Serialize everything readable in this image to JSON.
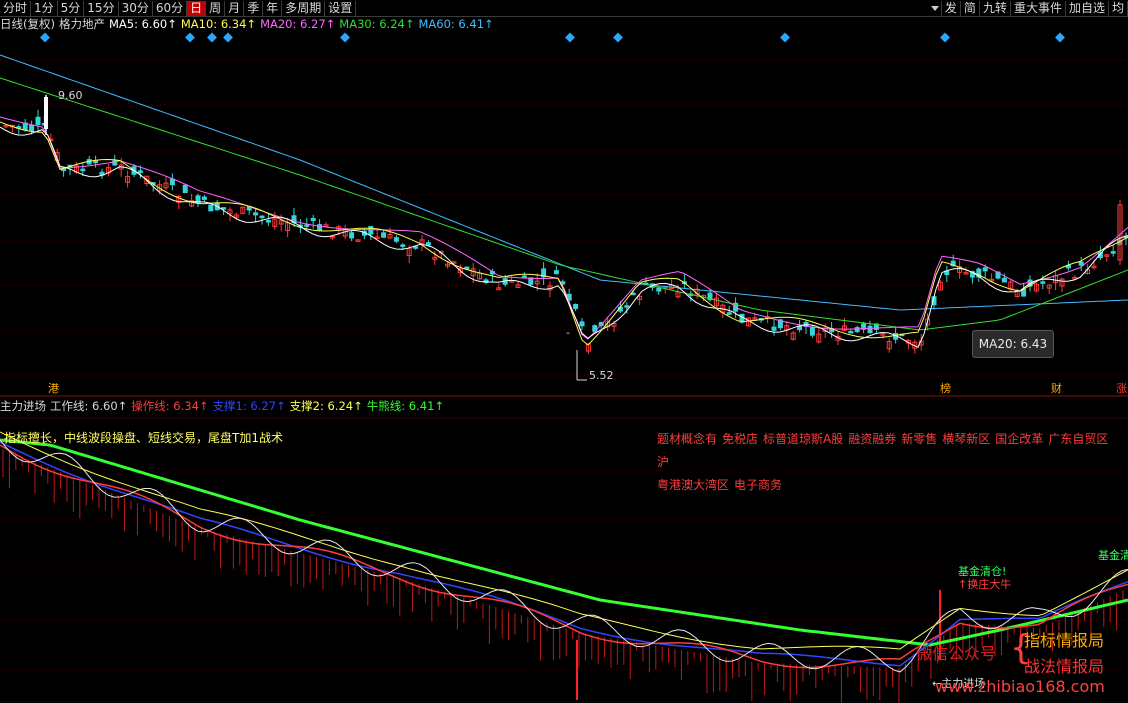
{
  "toolbar": {
    "left": [
      {
        "label": "分时",
        "active": false
      },
      {
        "label": "1分",
        "active": false
      },
      {
        "label": "5分",
        "active": false
      },
      {
        "label": "15分",
        "active": false
      },
      {
        "label": "30分",
        "active": false
      },
      {
        "label": "60分",
        "active": false
      },
      {
        "label": "日",
        "active": true
      },
      {
        "label": "周",
        "active": false
      },
      {
        "label": "月",
        "active": false
      },
      {
        "label": "季",
        "active": false
      },
      {
        "label": "年",
        "active": false
      },
      {
        "label": "多周期",
        "active": false
      },
      {
        "label": "设置",
        "active": false
      }
    ],
    "right": [
      "发",
      "简",
      "九转",
      "重大事件",
      "加自选",
      "均"
    ]
  },
  "upper_legend": [
    {
      "text": "日线(复权)",
      "color": "#d8d8d8"
    },
    {
      "text": "格力地产",
      "color": "#d8d8d8"
    },
    {
      "text": "MA5: 6.60↑",
      "color": "#ffffff"
    },
    {
      "text": "MA10: 6.34↑",
      "color": "#ffff55"
    },
    {
      "text": "MA20: 6.27↑",
      "color": "#ff66ff"
    },
    {
      "text": "MA30: 6.24↑",
      "color": "#33dd33"
    },
    {
      "text": "MA60: 6.41↑",
      "color": "#44bbff"
    }
  ],
  "lower_legend": [
    {
      "text": "主力进场",
      "color": "#d8d8d8"
    },
    {
      "text": "工作线: 6.60↑",
      "color": "#d8d8d8"
    },
    {
      "text": "操作线: 6.34↑",
      "color": "#ff3b3b"
    },
    {
      "text": "支撑1: 6.27↑",
      "color": "#3344ff"
    },
    {
      "text": "支撑2: 6.24↑",
      "color": "#ffff55"
    },
    {
      "text": "牛熊线: 6.41↑",
      "color": "#33ff33"
    }
  ],
  "price_labels": {
    "high": "9.60",
    "low": "5.52"
  },
  "tooltip": "MA20: 6.43",
  "bottom_markers": [
    {
      "text": "港",
      "color": "#ffaa00"
    },
    {
      "text": "榜",
      "color": "#ffaa00"
    },
    {
      "text": "财",
      "color": "#ffaa00"
    },
    {
      "text": "涨",
      "color": "#ff3b3b"
    }
  ],
  "note": "指标擅长，中线波段操盘、短线交易，尾盘T加1战术",
  "concept_tags": [
    "题材概念有",
    "免税店",
    "标普道琼斯A股",
    "融资融券",
    "新零售",
    "横琴新区",
    "国企改革",
    "广东自贸区",
    "沪",
    "粤港澳大湾区",
    "电子商务"
  ],
  "annotations": {
    "fund_clear": "基金清仓!",
    "fund_clear2": "基金清",
    "dragon": "↑换庄大牛",
    "entry": "←主力进场",
    "lowdash": "-"
  },
  "watermark": {
    "wechat": "微信公众号",
    "line1": "指标情报局",
    "line2": "战法情报局",
    "url": "www.zhibiao168.com",
    "brace": "{"
  },
  "colors": {
    "up": "#ff3b3b",
    "down": "#33d6d6",
    "ma5": "#ffffff",
    "ma10": "#ffff55",
    "ma20": "#ff66ff",
    "ma30": "#33dd33",
    "ma60": "#44bbff"
  }
}
